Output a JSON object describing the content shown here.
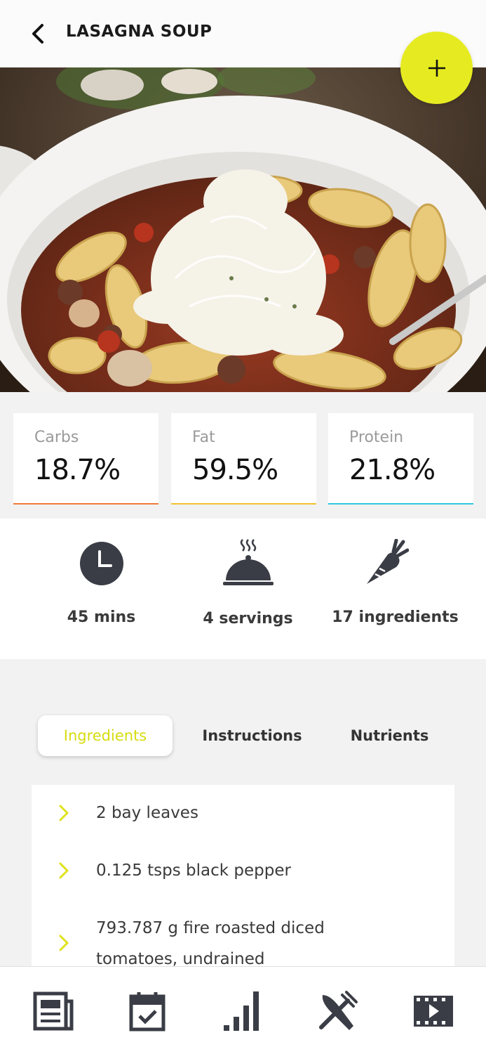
{
  "header": {
    "title": "LASAGNA SOUP",
    "back_icon": "chevron-left-icon",
    "add_icon": "plus-icon",
    "accent_color": "#e6eb21"
  },
  "macros": [
    {
      "label": "Carbs",
      "value": "18.7%",
      "color": "#f07a3a"
    },
    {
      "label": "Fat",
      "value": "59.5%",
      "color": "#f2c230"
    },
    {
      "label": "Protein",
      "value": "21.8%",
      "color": "#2ec8dc"
    }
  ],
  "stats": [
    {
      "icon": "clock-icon",
      "text": "45 mins"
    },
    {
      "icon": "serving-cloche-icon",
      "text": "4 servings"
    },
    {
      "icon": "carrot-icon",
      "text": "17 ingredients"
    }
  ],
  "tabs": [
    {
      "label": "Ingredients",
      "active": true
    },
    {
      "label": "Instructions",
      "active": false
    },
    {
      "label": "Nutrients",
      "active": false
    }
  ],
  "ingredients": [
    {
      "text": "2 bay leaves"
    },
    {
      "text": "0.125 tsps black pepper"
    },
    {
      "text": "793.787 g fire roasted diced tomatoes, undrained"
    }
  ],
  "nav": [
    {
      "icon": "news-icon"
    },
    {
      "icon": "calendar-check-icon"
    },
    {
      "icon": "bar-chart-icon"
    },
    {
      "icon": "fork-knife-icon"
    },
    {
      "icon": "video-icon"
    }
  ]
}
